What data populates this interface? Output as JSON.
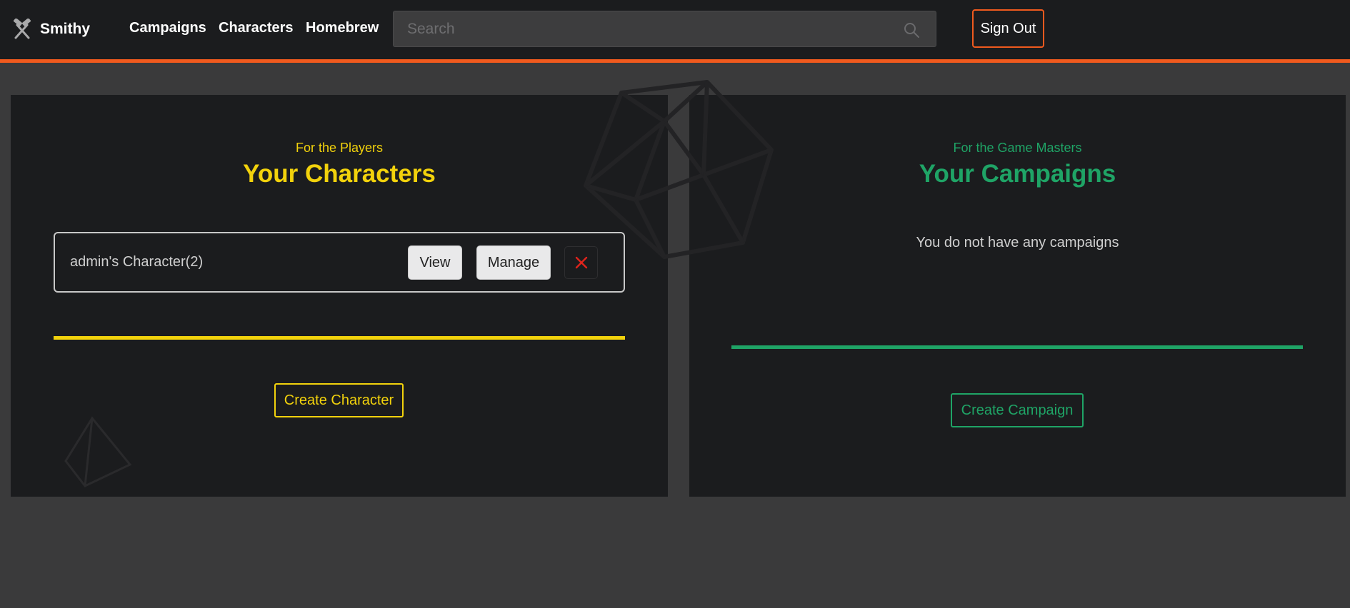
{
  "brand": {
    "name": "Smithy",
    "icon": "crossed-hammers-icon"
  },
  "nav": {
    "links": [
      {
        "label": "Campaigns"
      },
      {
        "label": "Characters"
      },
      {
        "label": "Homebrew"
      }
    ],
    "search": {
      "placeholder": "Search",
      "value": "",
      "icon": "search-icon"
    },
    "sign_out": "Sign Out"
  },
  "players": {
    "subtitle": "For the Players",
    "title": "Your Characters",
    "characters": [
      {
        "name": "admin's Character(2)",
        "view_label": "View",
        "manage_label": "Manage",
        "delete_icon": "close-icon"
      }
    ],
    "create_label": "Create Character"
  },
  "game_masters": {
    "subtitle": "For the Game Masters",
    "title": "Your Campaigns",
    "empty_message": "You do not have any campaigns",
    "create_label": "Create Campaign"
  },
  "colors": {
    "accent_orange": "#f05a1e",
    "players_yellow": "#f2d20c",
    "gm_green": "#1fa466",
    "panel_bg": "#1b1c1e",
    "page_bg": "#3a3a3b",
    "delete_red": "#e0241c"
  }
}
